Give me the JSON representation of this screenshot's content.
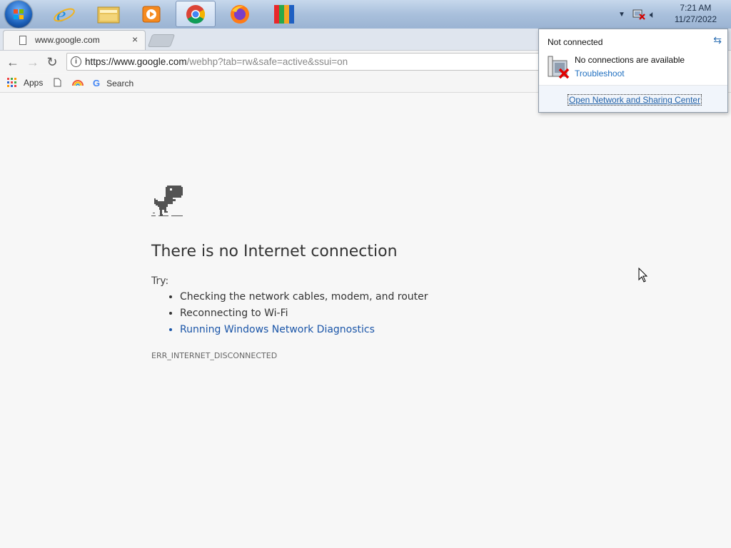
{
  "taskbar": {
    "apps": [
      {
        "name": "Internet Explorer",
        "icon": "internet-explorer-icon"
      },
      {
        "name": "Windows Explorer",
        "icon": "folder-icon"
      },
      {
        "name": "Windows Media Player",
        "icon": "media-player-icon"
      },
      {
        "name": "Google Chrome",
        "icon": "chrome-icon",
        "active": true
      },
      {
        "name": "Firefox",
        "icon": "firefox-icon"
      },
      {
        "name": "AVG",
        "icon": "avg-icon"
      }
    ],
    "clock_time": "7:21 AM",
    "clock_date": "11/27/2022"
  },
  "browser": {
    "tab_title": "www.google.com",
    "tab_close": "×",
    "url_host": "https://www.google.com",
    "url_path": "/webhp?tab=rw&safe=active&ssui=on",
    "bookmarks": {
      "apps_label": "Apps",
      "search_label": "Search"
    }
  },
  "error_page": {
    "title": "There is no Internet connection",
    "try_label": "Try:",
    "suggestions": [
      "Checking the network cables, modem, and router",
      "Reconnecting to Wi-Fi",
      "Running Windows Network Diagnostics"
    ],
    "error_code": "ERR_INTERNET_DISCONNECTED"
  },
  "network_flyout": {
    "header": "Not connected",
    "status": "No connections are available",
    "troubleshoot": "Troubleshoot",
    "open_center": "Open Network and Sharing Center"
  },
  "colors": {
    "link_blue": "#1a55a8",
    "page_bg": "#f7f7f7",
    "taskbar_blue": "#a9c0dc"
  }
}
